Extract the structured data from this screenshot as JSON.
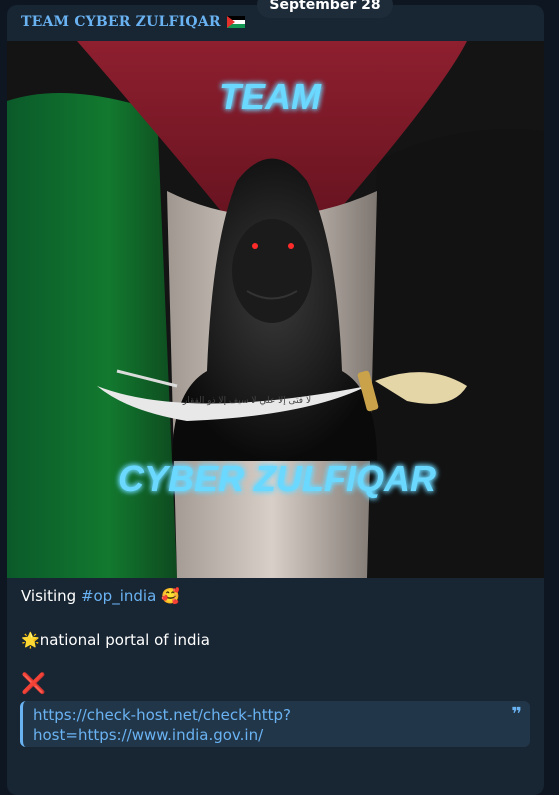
{
  "date_label": "September 28",
  "channel": {
    "name": "TEAM CYBER ZULFIQAR"
  },
  "image": {
    "top_text": "TEAM",
    "bottom_text": "CYBER ZULFIQAR",
    "sword_inscription": "لا فتى إلا علي لا سيف إلا ذو الفقار"
  },
  "message": {
    "line1_prefix": "Visiting ",
    "hashtag": "#op_india",
    "line1_emoji": "🥰",
    "line2_emoji": "🌟",
    "line2_text": "national portal of india",
    "status_emoji": "❌",
    "quote_link": "https://check-host.net/check-http?host=https://www.india.gov.in/",
    "quote_line1": "https://check-host.net/check-http?",
    "quote_line2": "host=https://www.india.gov.in/",
    "quote_icon": "❞"
  },
  "colors": {
    "link": "#6ab3f3",
    "bubble": "#182533",
    "background": "#0e1621",
    "error": "#e53935",
    "neon_blue": "#3ec8ff"
  }
}
